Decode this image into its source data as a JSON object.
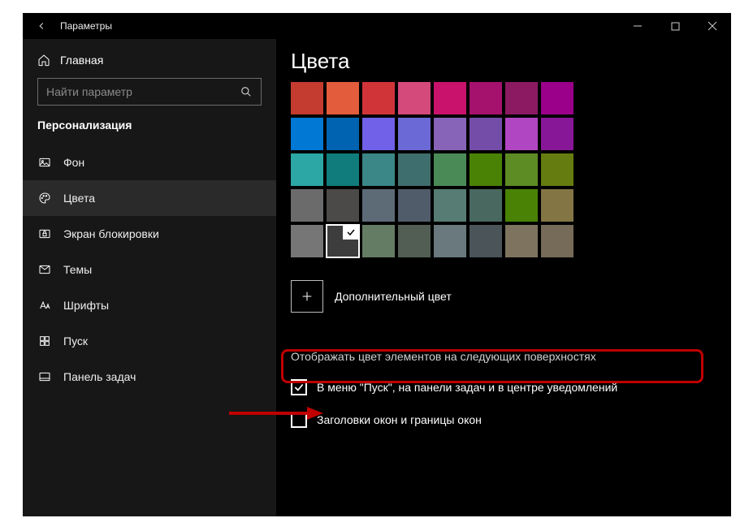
{
  "titlebar": {
    "back_label": "Назад",
    "title": "Параметры",
    "min": "−",
    "max": "▢",
    "close": "✕"
  },
  "sidebar": {
    "home_label": "Главная",
    "search_placeholder": "Найти параметр",
    "section_head": "Персонализация",
    "items": [
      {
        "icon": "image-icon",
        "label": "Фон"
      },
      {
        "icon": "palette-icon",
        "label": "Цвета",
        "selected": true
      },
      {
        "icon": "lock-icon",
        "label": "Экран блокировки"
      },
      {
        "icon": "themes-icon",
        "label": "Темы"
      },
      {
        "icon": "fonts-icon",
        "label": "Шрифты"
      },
      {
        "icon": "start-icon",
        "label": "Пуск"
      },
      {
        "icon": "taskbar-icon",
        "label": "Панель задач"
      }
    ]
  },
  "main": {
    "page_title": "Цвета",
    "palette": [
      [
        "#c43b2f",
        "#e35c3c",
        "#d13438",
        "#d44a7a",
        "#c9126b",
        "#a4126d",
        "#8b1a62",
        "#9a0089"
      ],
      [
        "#0078d4",
        "#0063b1",
        "#7160e8",
        "#6b69d6",
        "#8764b8",
        "#744da9",
        "#b146c2",
        "#881798"
      ],
      [
        "#2ca7a6",
        "#107c7b",
        "#3b8686",
        "#3f6e6e",
        "#4a8a57",
        "#498205",
        "#5d8b24",
        "#647c10"
      ],
      [
        "#6b6b6b",
        "#4c4a48",
        "#5d6b77",
        "#515c6b",
        "#567c73",
        "#486860",
        "#498205",
        "#847545"
      ],
      [
        "#767676",
        "#3d3d3d",
        "#647c64",
        "#525e54",
        "#69797e",
        "#4a5459",
        "#7e735f",
        "#766b59"
      ]
    ],
    "selected_swatch": {
      "row": 4,
      "col": 1
    },
    "more_color_label": "Дополнительный цвет",
    "surfaces_head": "Отображать цвет элементов на следующих поверхностях",
    "checkboxes": [
      {
        "checked": true,
        "label": "В меню \"Пуск\", на панели задач и в центре уведомлений"
      },
      {
        "checked": false,
        "label": "Заголовки окон и границы окон"
      }
    ]
  }
}
